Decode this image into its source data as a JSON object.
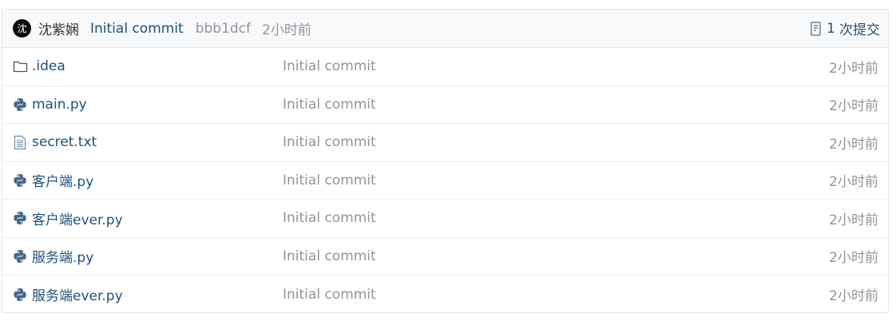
{
  "header": {
    "avatar_text": "沈",
    "author": "沈紫娴",
    "commit_message": "Initial commit",
    "sha": "bbb1dcf",
    "time": "2小时前",
    "commit_count": "1",
    "commit_count_label": "次提交"
  },
  "files": [
    {
      "name": ".idea",
      "type": "folder",
      "icon": "folder-icon",
      "message": "Initial commit",
      "time": "2小时前"
    },
    {
      "name": "main.py",
      "type": "python",
      "icon": "python-icon",
      "message": "Initial commit",
      "time": "2小时前"
    },
    {
      "name": "secret.txt",
      "type": "text",
      "icon": "text-file-icon",
      "message": "Initial commit",
      "time": "2小时前"
    },
    {
      "name": "客户端.py",
      "type": "python",
      "icon": "python-icon",
      "message": "Initial commit",
      "time": "2小时前"
    },
    {
      "name": "客户端ever.py",
      "type": "python",
      "icon": "python-icon",
      "message": "Initial commit",
      "time": "2小时前"
    },
    {
      "name": "服务端.py",
      "type": "python",
      "icon": "python-icon",
      "message": "Initial commit",
      "time": "2小时前"
    },
    {
      "name": "服务端ever.py",
      "type": "python",
      "icon": "python-icon",
      "message": "Initial commit",
      "time": "2小时前"
    }
  ],
  "colors": {
    "link": "#1f4f7a",
    "muted": "#8f959b",
    "icon": "#3d5f7d",
    "header_bg": "#f8f9fa",
    "border": "#e3e5e8"
  }
}
